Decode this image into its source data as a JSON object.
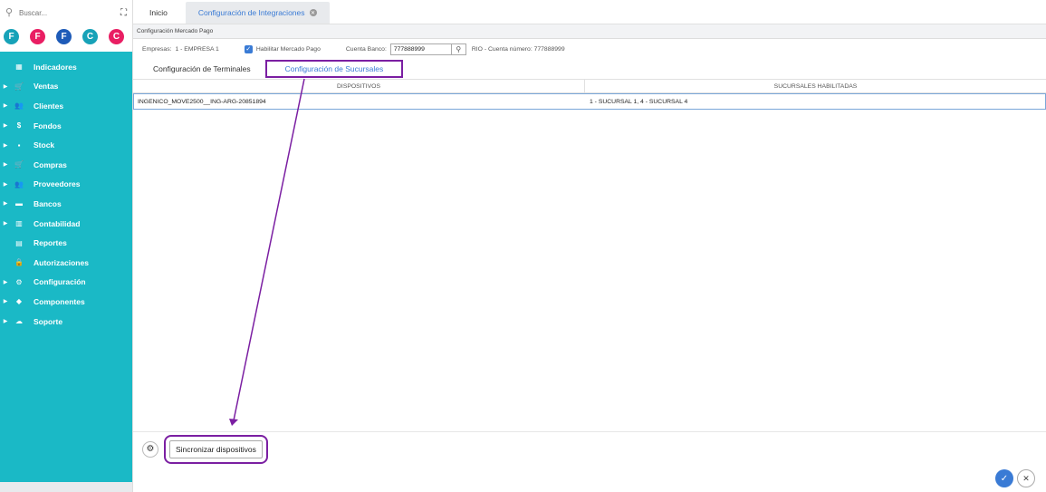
{
  "sidebar": {
    "search_placeholder": "Buscar...",
    "avatars": [
      {
        "letter": "F",
        "color": "#17a2b8"
      },
      {
        "letter": "F",
        "color": "#e91e63"
      },
      {
        "letter": "F",
        "color": "#1e5bb8"
      },
      {
        "letter": "C",
        "color": "#17a2b8"
      },
      {
        "letter": "C",
        "color": "#e91e63"
      }
    ],
    "items": [
      {
        "label": "Indicadores",
        "icon": "dashboard-icon",
        "glyph": "▦",
        "caret": false
      },
      {
        "label": "Ventas",
        "icon": "cart-icon",
        "glyph": "🛒",
        "caret": true
      },
      {
        "label": "Clientes",
        "icon": "people-icon",
        "glyph": "👥",
        "caret": true
      },
      {
        "label": "Fondos",
        "icon": "dollar-icon",
        "glyph": "$",
        "caret": true
      },
      {
        "label": "Stock",
        "icon": "box-icon",
        "glyph": "▪",
        "caret": true
      },
      {
        "label": "Compras",
        "icon": "cart-icon",
        "glyph": "🛒",
        "caret": true
      },
      {
        "label": "Proveedores",
        "icon": "people-icon",
        "glyph": "👥",
        "caret": true
      },
      {
        "label": "Bancos",
        "icon": "briefcase-icon",
        "glyph": "▬",
        "caret": true
      },
      {
        "label": "Contabilidad",
        "icon": "book-icon",
        "glyph": "▥",
        "caret": true
      },
      {
        "label": "Reportes",
        "icon": "report-icon",
        "glyph": "▤",
        "caret": false
      },
      {
        "label": "Autorizaciones",
        "icon": "lock-icon",
        "glyph": "🔒",
        "caret": false
      },
      {
        "label": "Configuración",
        "icon": "settings-icon",
        "glyph": "⚙",
        "caret": true
      },
      {
        "label": "Componentes",
        "icon": "tag-icon",
        "glyph": "◆",
        "caret": true
      },
      {
        "label": "Soporte",
        "icon": "cloud-icon",
        "glyph": "☁",
        "caret": true
      }
    ]
  },
  "tabs": {
    "home": "Inicio",
    "active": "Configuración de Integraciones"
  },
  "subheader": "Configuración Mercado Pago",
  "filters": {
    "empresas_label": "Empresas:",
    "empresas_value": "1 - EMPRESA 1",
    "habilitar_label": "Habilitar Mercado Pago",
    "cuenta_label": "Cuenta Banco:",
    "cuenta_value": "777888999",
    "cuenta_desc": "RIO - Cuenta número: 777888999"
  },
  "subtabs": {
    "terminales": "Configuración de Terminales",
    "sucursales": "Configuración de Sucursales"
  },
  "table": {
    "headers": [
      "DISPOSITIVOS",
      "SUCURSALES HABILITADAS"
    ],
    "rows": [
      [
        "INGENICO_MOVE2500__ING-ARG-20851894",
        "1 - SUCURSAL 1, 4 - SUCURSAL 4"
      ]
    ]
  },
  "footer": {
    "sync_label": "Sincronizar dispositivos"
  },
  "colors": {
    "sidebar": "#1ab9c6",
    "accent": "#3a7bd5",
    "annotation": "#7b1fa2"
  }
}
